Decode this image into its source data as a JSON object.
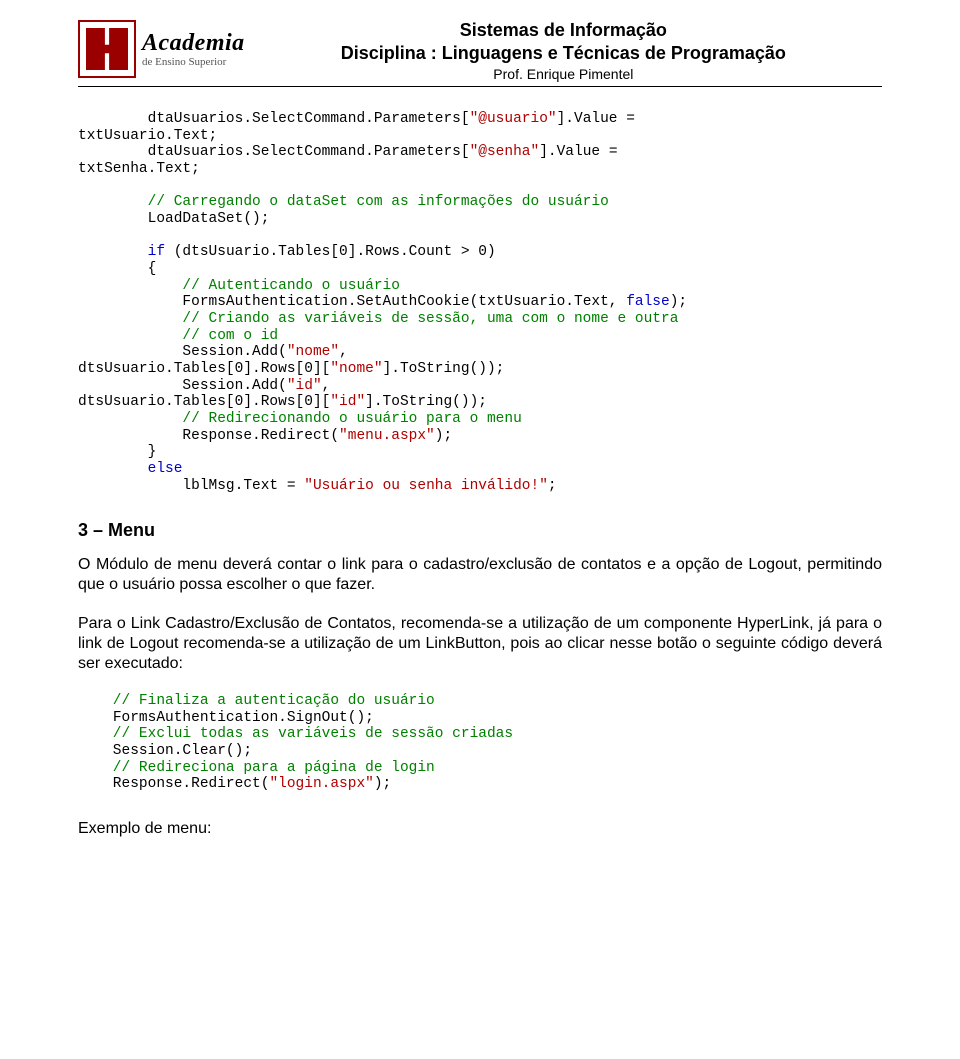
{
  "logo": {
    "name": "Academia",
    "subtitle": "de Ensino Superior"
  },
  "header": {
    "line1": "Sistemas de Informação",
    "line2": "Disciplina : Linguagens e Técnicas de Programação",
    "line3": "Prof. Enrique Pimentel"
  },
  "code1": {
    "l01a": "        dtaUsuarios.SelectCommand.Parameters[",
    "l01b": "\"@usuario\"",
    "l01c": "].Value = ",
    "l02": "txtUsuario.Text;",
    "l03a": "        dtaUsuarios.SelectCommand.Parameters[",
    "l03b": "\"@senha\"",
    "l03c": "].Value = ",
    "l04": "txtSenha.Text;",
    "blank1": "",
    "l05": "        // Carregando o dataSet com as informações do usuário",
    "l06": "        LoadDataSet();",
    "blank2": "",
    "l07a": "        ",
    "l07b": "if",
    "l07c": " (dtsUsuario.Tables[0].Rows.Count > 0)",
    "l08": "        {",
    "l09": "            // Autenticando o usuário",
    "l10a": "            ",
    "l10b": "FormsAuthentication",
    "l10c": ".SetAuthCookie(txtUsuario.Text, ",
    "l10d": "false",
    "l10e": ");",
    "l11": "            // Criando as variáveis de sessão, uma com o nome e outra",
    "l12": "            // com o id",
    "l13a": "            Session.Add(",
    "l13b": "\"nome\"",
    "l13c": ", ",
    "l14a": "dtsUsuario.Tables[0].Rows[0][",
    "l14b": "\"nome\"",
    "l14c": "].ToString());",
    "l15a": "            Session.Add(",
    "l15b": "\"id\"",
    "l15c": ", ",
    "l16a": "dtsUsuario.Tables[0].Rows[0][",
    "l16b": "\"id\"",
    "l16c": "].ToString());",
    "l17": "            // Redirecionando o usuário para o menu",
    "l18a": "            Response.Redirect(",
    "l18b": "\"menu.aspx\"",
    "l18c": ");",
    "l19": "        }",
    "l20a": "        ",
    "l20b": "else",
    "l21a": "            lblMsg.Text = ",
    "l21b": "\"Usuário ou senha inválido!\"",
    "l21c": ";"
  },
  "section3_title": "3 – Menu",
  "para1": "O Módulo de menu deverá contar o link para o cadastro/exclusão de contatos e a opção de Logout, permitindo que o usuário possa escolher o que fazer.",
  "para2": "Para o Link Cadastro/Exclusão de Contatos, recomenda-se a utilização de um componente HyperLink, já para o link de Logout recomenda-se a utilização de um LinkButton, pois ao clicar nesse botão o seguinte código deverá ser executado:",
  "code2": {
    "l01": "    // Finaliza a autenticação do usuário",
    "l02a": "    ",
    "l02b": "FormsAuthentication",
    "l02c": ".SignOut();",
    "l03": "    // Exclui todas as variáveis de sessão criadas",
    "l04": "    Session.Clear();",
    "l05": "    // Redireciona para a página de login",
    "l06a": "    Response.Redirect(",
    "l06b": "\"login.aspx\"",
    "l06c": ");"
  },
  "footer_label": "Exemplo de menu:"
}
